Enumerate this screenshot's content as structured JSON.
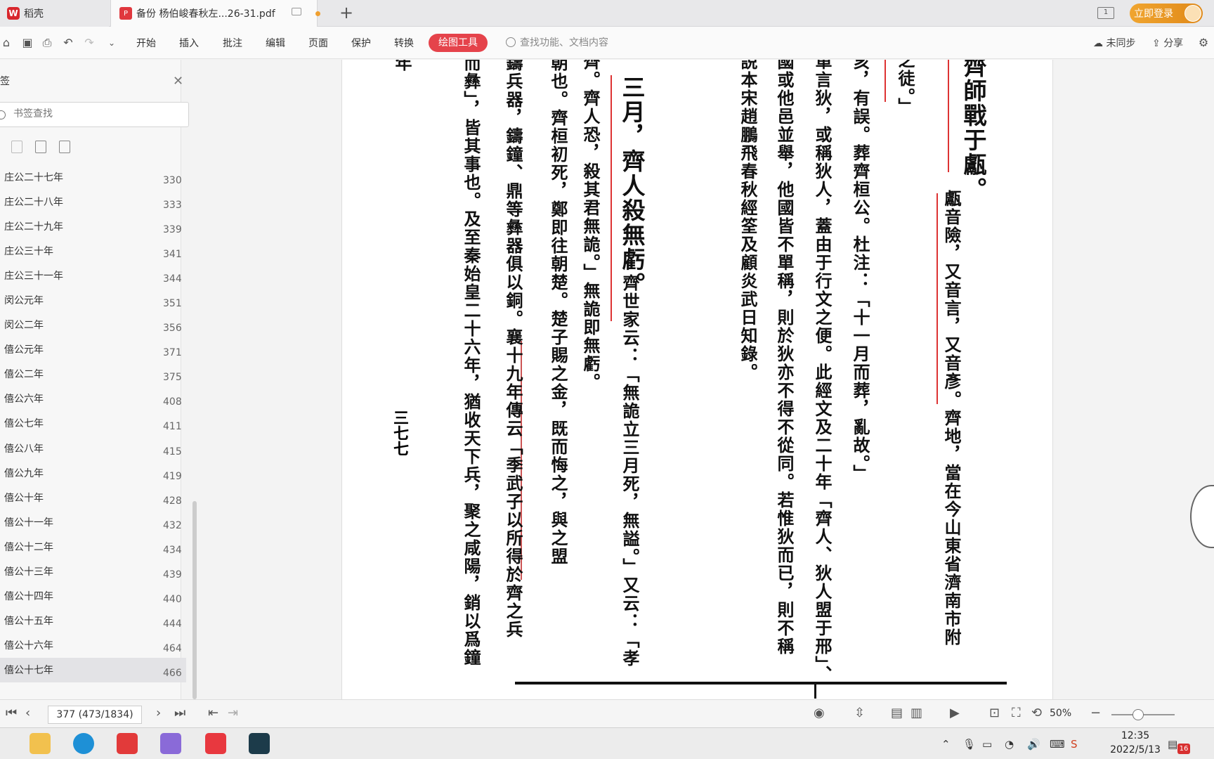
{
  "tabs": {
    "home_label": "稻壳",
    "doc_label": "备份 杨伯峻春秋左...26-31.pdf",
    "login": "立即登录",
    "window_badge": "1"
  },
  "toolbar": {
    "menus": [
      "开始",
      "插入",
      "批注",
      "编辑",
      "页面",
      "保护",
      "转换"
    ],
    "active_menu": "绘图工具",
    "search_placeholder": "查找功能、文档内容",
    "sync": "未同步",
    "share": "分享"
  },
  "sidebar": {
    "title": "签",
    "search_placeholder": "书签查找",
    "items": [
      {
        "label": "庄公二十七年",
        "page": "330"
      },
      {
        "label": "庄公二十八年",
        "page": "333"
      },
      {
        "label": "庄公二十九年",
        "page": "339"
      },
      {
        "label": "庄公三十年",
        "page": "341"
      },
      {
        "label": "庄公三十一年",
        "page": "344"
      },
      {
        "label": "闵公元年",
        "page": "351"
      },
      {
        "label": "闵公二年",
        "page": "356"
      },
      {
        "label": "僖公元年",
        "page": "371"
      },
      {
        "label": "僖公二年",
        "page": "375"
      },
      {
        "label": "僖公六年",
        "page": "408"
      },
      {
        "label": "僖公七年",
        "page": "411"
      },
      {
        "label": "僖公八年",
        "page": "415"
      },
      {
        "label": "僖公九年",
        "page": "419"
      },
      {
        "label": "僖公十年",
        "page": "428"
      },
      {
        "label": "僖公十一年",
        "page": "432"
      },
      {
        "label": "僖公十二年",
        "page": "434"
      },
      {
        "label": "僖公十三年",
        "page": "439"
      },
      {
        "label": "僖公十四年",
        "page": "440"
      },
      {
        "label": "僖公十五年",
        "page": "444"
      },
      {
        "label": "僖公十六年",
        "page": "464"
      },
      {
        "label": "僖公十七年",
        "page": "466"
      }
    ]
  },
  "document": {
    "columns": [
      "齊師戰于甗。",
      "甗音險，又音言，又音彥。齊地，當在今山東省濟南市附",
      "之徒。」",
      "亥，有誤。葬齊桓公。杜注：「十一月而葬，亂故。」",
      "單言狄，或稱狄人，蓋由于行文之便。此經文及二十年「齊人、狄人盟于邢」、",
      "國或他邑並舉，他國皆不單稱，則於狄亦不得不從同。若惟狄而已，則不稱",
      "説本宋趙鵬飛春秋經筌及顧炎武日知錄。",
      "三月，齊人殺無虧。",
      "齊世家云：「無詭立三月死，無謚。」又云：「孝",
      "齊。齊人恐，殺其君無詭。」無詭即無虧。",
      "朝也。齊桓初死，鄭即往朝楚。楚子賜之金，既而悔之，與之盟",
      "鑄兵器，鑄鐘、鼎等彝器俱以銅。襄十九年傳云「季武子以所得於齊之兵",
      "而彝」，皆其事也。及至秦始皇二十六年，猶收天下兵，聚之咸陽，銷以爲鐘",
      "年"
    ],
    "page_number": "三七七"
  },
  "statusbar": {
    "page_display": "377 (473/1834)",
    "zoom": "50%"
  },
  "taskbar": {
    "time": "12:35",
    "date": "2022/5/13",
    "notifications": "16"
  }
}
